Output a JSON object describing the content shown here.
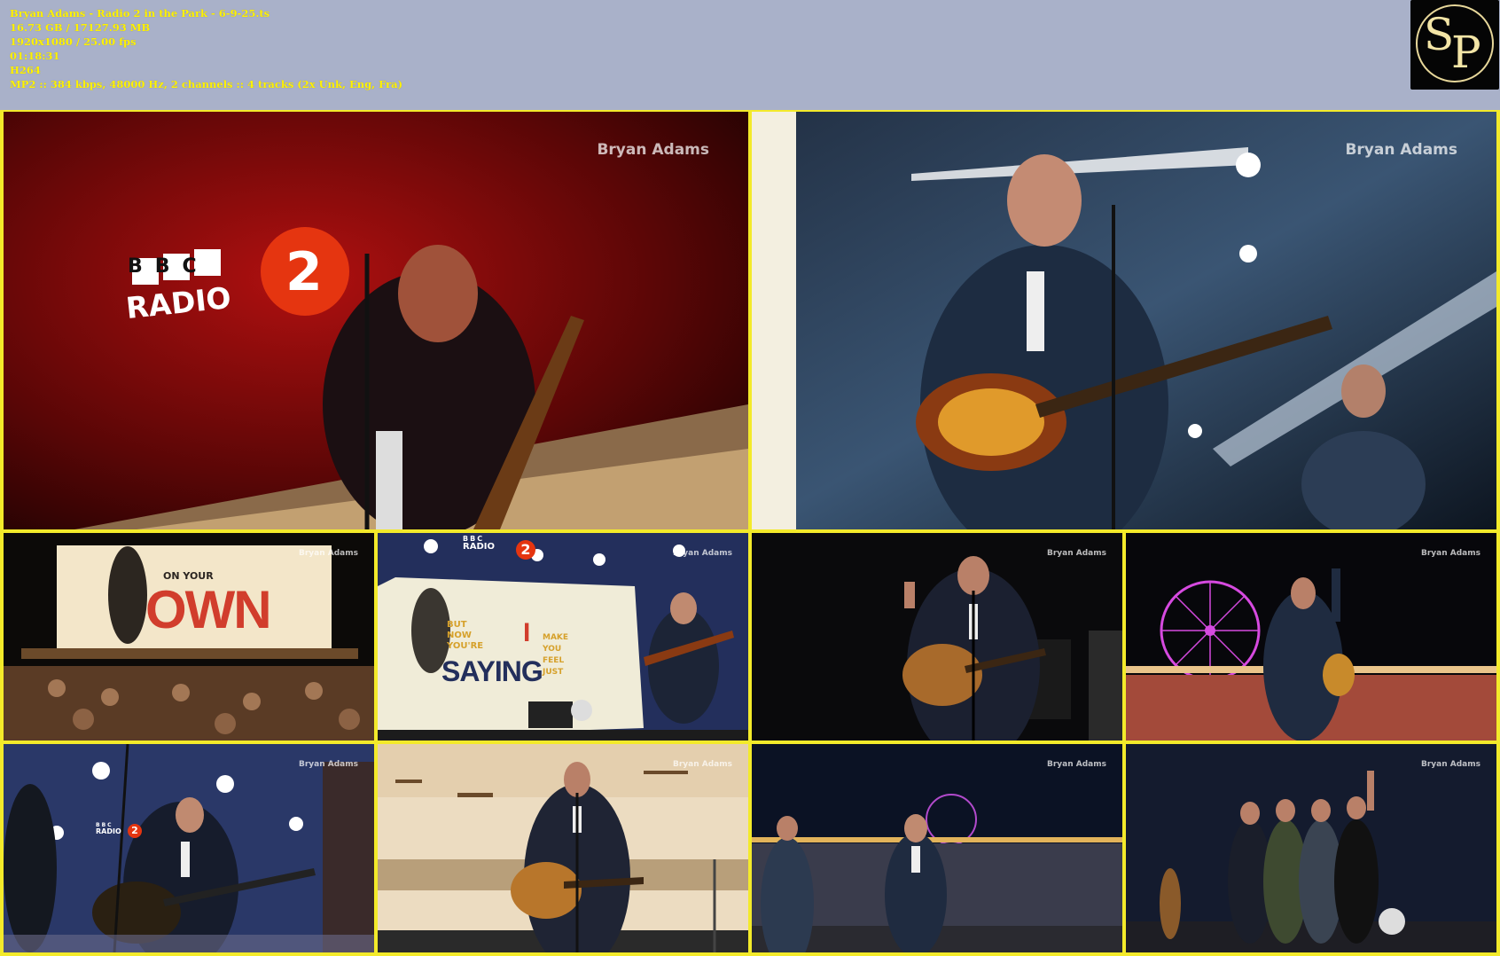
{
  "file_info": {
    "name": "Bryan Adams - Radio 2 in the Park - 6-9-25.ts",
    "size": "16.73 GB / 17127.93 MB",
    "resolution": "1920x1080 / 25.00 fps",
    "duration": "01:18:31",
    "codec": "H264",
    "audio": "MP2 :: 384 kbps, 48000 Hz, 2 channels :: 4 tracks (2x Unk, Eng, Fra)"
  },
  "logo": {
    "letter1": "S",
    "letter2": "P"
  },
  "watermark": "Bryan Adams",
  "stage_text": {
    "bbc": "BBC",
    "radio": "RADIO",
    "two": "2",
    "on_your": "ON YOUR",
    "own": "OWN",
    "but_now": "BUT NOW YOU'RE",
    "saying": "SAYING",
    "i": "I",
    "make_you": "MAKE YOU FEEL JUST"
  }
}
